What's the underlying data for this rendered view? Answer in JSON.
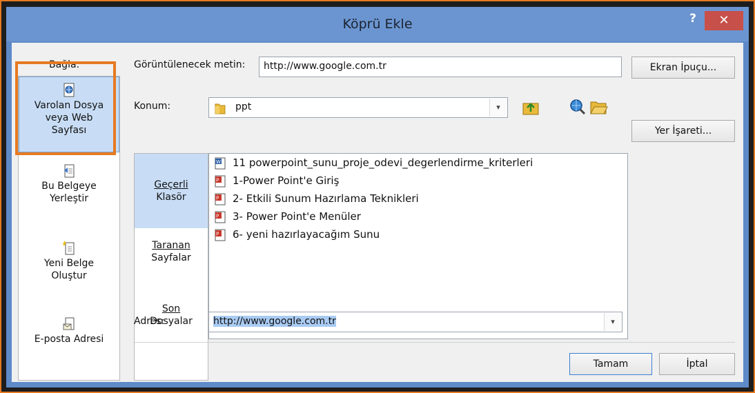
{
  "dialog": {
    "title": "Köprü Ekle",
    "help": "?",
    "close": "✕"
  },
  "link_to": {
    "label": "Bağla:",
    "items": [
      {
        "line1": "Varolan Dosya",
        "line2": "veya Web",
        "line3": "Sayfası",
        "icon": "globe-document-icon"
      },
      {
        "line1": "Bu Belgeye",
        "line2": "Yerleştir",
        "icon": "document-bookmark-icon"
      },
      {
        "line1": "Yeni Belge",
        "line2": "Oluştur",
        "icon": "new-document-icon"
      },
      {
        "line1": "E-posta Adresi",
        "icon": "email-icon"
      }
    ]
  },
  "display_text": {
    "label": "Görüntülenecek metin:",
    "value": "http://www.google.com.tr"
  },
  "screentip_button": "Ekran İpuçu...",
  "look_in": {
    "label": "Konum:",
    "value": "ppt"
  },
  "bookmark_button": "Yer İşareti...",
  "browse_nav": {
    "current": {
      "line1": "Geçerli",
      "line2": "Klasör"
    },
    "browsed": {
      "line1": "Taranan",
      "line2": "Sayfalar"
    },
    "recent": {
      "line1": "Son",
      "line2": "Dosyalar"
    }
  },
  "files": [
    {
      "name": "11 powerpoint_sunu_proje_odevi_degerlendirme_kriterleri",
      "type": "word"
    },
    {
      "name": "1-Power Point'e Giriş",
      "type": "ppt"
    },
    {
      "name": "2- Etkili Sunum Hazırlama Teknikleri",
      "type": "ppt"
    },
    {
      "name": "3- Power Point'e Menüler",
      "type": "ppt"
    },
    {
      "name": "6- yeni hazırlayacağım Sunu",
      "type": "ppt"
    }
  ],
  "address": {
    "label": "Adres:",
    "value": "http://www.google.com.tr"
  },
  "ok_button": "Tamam",
  "cancel_button": "İptal",
  "colors": {
    "title_bar": "#6b95d0",
    "close": "#c7504a",
    "highlight_outline": "#e67a22",
    "selection": "#c8ddf5"
  }
}
